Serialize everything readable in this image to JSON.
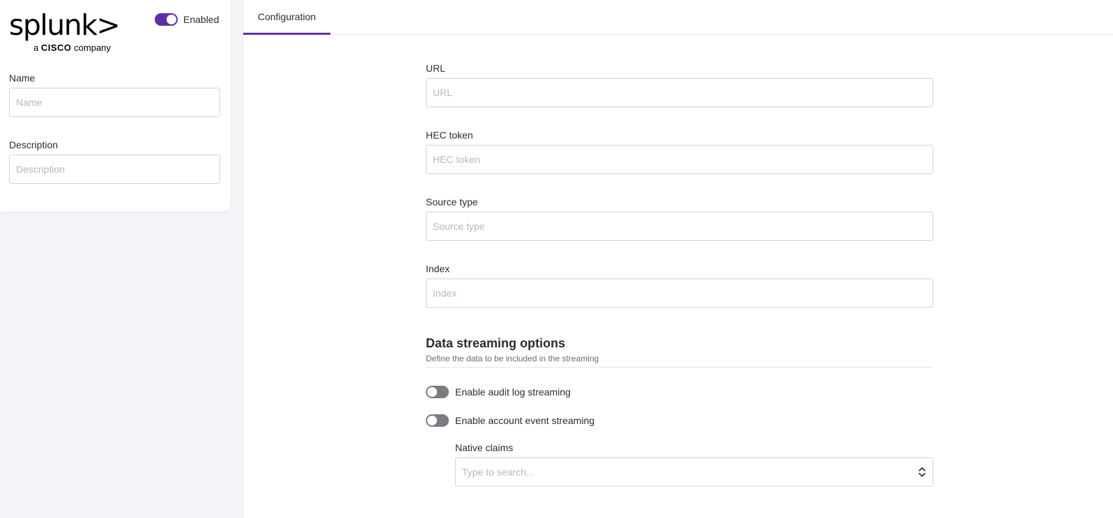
{
  "header": {
    "logo_word": "splunk>",
    "logo_prefix": "a",
    "logo_brand": "CISCO",
    "logo_suffix": "company",
    "enabled_label": "Enabled",
    "enabled_on": true
  },
  "left": {
    "name_label": "Name",
    "name_placeholder": "Name",
    "name_value": "",
    "description_label": "Description",
    "description_placeholder": "Description",
    "description_value": ""
  },
  "tabs": [
    {
      "label": "Configuration",
      "active": true
    }
  ],
  "config": {
    "url_label": "URL",
    "url_placeholder": "URL",
    "hec_label": "HEC token",
    "hec_placeholder": "HEC token",
    "source_label": "Source type",
    "source_placeholder": "Source type",
    "index_label": "Index",
    "index_placeholder": "Index"
  },
  "streaming": {
    "title": "Data streaming options",
    "subtitle": "Define the data to be included in the streaming",
    "audit_label": "Enable audit log streaming",
    "audit_on": false,
    "account_label": "Enable account event streaming",
    "account_on": false,
    "claims_label": "Native claims",
    "claims_placeholder": "Type to search..."
  },
  "colors": {
    "accent": "#5c2fa8",
    "toggle_off": "#7b7b80",
    "background": "#f3f4f8"
  },
  "icons": {
    "select_chevron": "chevron-up-down-icon"
  }
}
